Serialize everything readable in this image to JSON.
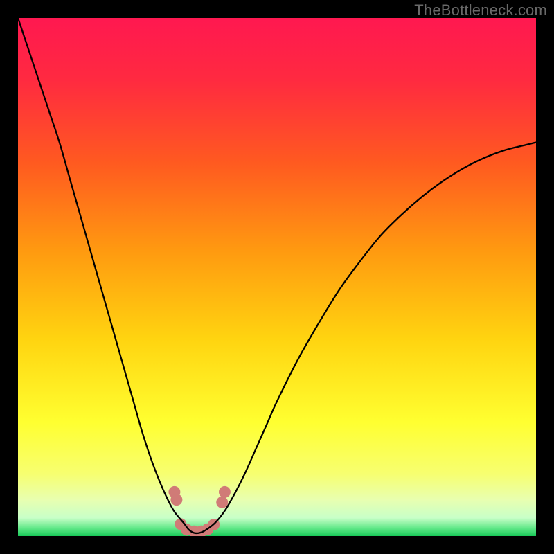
{
  "watermark": "TheBottleneck.com",
  "colors": {
    "border": "#000000",
    "gradient_stops": [
      {
        "offset": 0.0,
        "color": "#ff1850"
      },
      {
        "offset": 0.12,
        "color": "#ff2a40"
      },
      {
        "offset": 0.28,
        "color": "#ff5a20"
      },
      {
        "offset": 0.45,
        "color": "#ff9a10"
      },
      {
        "offset": 0.62,
        "color": "#ffd410"
      },
      {
        "offset": 0.78,
        "color": "#ffff30"
      },
      {
        "offset": 0.88,
        "color": "#f7ff70"
      },
      {
        "offset": 0.93,
        "color": "#e8ffb0"
      },
      {
        "offset": 0.965,
        "color": "#c8ffc8"
      },
      {
        "offset": 0.985,
        "color": "#60e888"
      },
      {
        "offset": 1.0,
        "color": "#18c858"
      }
    ],
    "curve": "#000000",
    "markers": "#d07b77"
  },
  "chart_data": {
    "type": "line",
    "title": "",
    "xlabel": "",
    "ylabel": "",
    "xlim": [
      0,
      100
    ],
    "ylim": [
      0,
      100
    ],
    "x": [
      0,
      2,
      4,
      6,
      8,
      10,
      12,
      14,
      16,
      18,
      20,
      22,
      24,
      26,
      28,
      30,
      32,
      33,
      34,
      35,
      36,
      38,
      40,
      42,
      44,
      46,
      48,
      50,
      54,
      58,
      62,
      66,
      70,
      74,
      78,
      82,
      86,
      90,
      94,
      98,
      100
    ],
    "values": [
      100,
      94,
      88,
      82,
      76,
      69,
      62,
      55,
      48,
      41,
      34,
      27,
      20,
      14,
      9,
      5,
      2.5,
      1.2,
      0.6,
      0.6,
      1.0,
      2.5,
      5.0,
      8.5,
      12.5,
      17,
      21.5,
      26,
      34,
      41,
      47.5,
      53,
      58,
      62,
      65.5,
      68.5,
      71,
      73,
      74.5,
      75.5,
      76
    ],
    "markers": [
      {
        "x": 30.2,
        "y": 8.5
      },
      {
        "x": 30.6,
        "y": 7.0
      },
      {
        "x": 31.4,
        "y": 2.3
      },
      {
        "x": 32.6,
        "y": 1.2
      },
      {
        "x": 34.0,
        "y": 0.9
      },
      {
        "x": 35.4,
        "y": 0.9
      },
      {
        "x": 36.6,
        "y": 1.3
      },
      {
        "x": 37.8,
        "y": 2.2
      },
      {
        "x": 39.4,
        "y": 6.5
      },
      {
        "x": 39.9,
        "y": 8.5
      }
    ],
    "marker_radius_px": 8.5
  }
}
